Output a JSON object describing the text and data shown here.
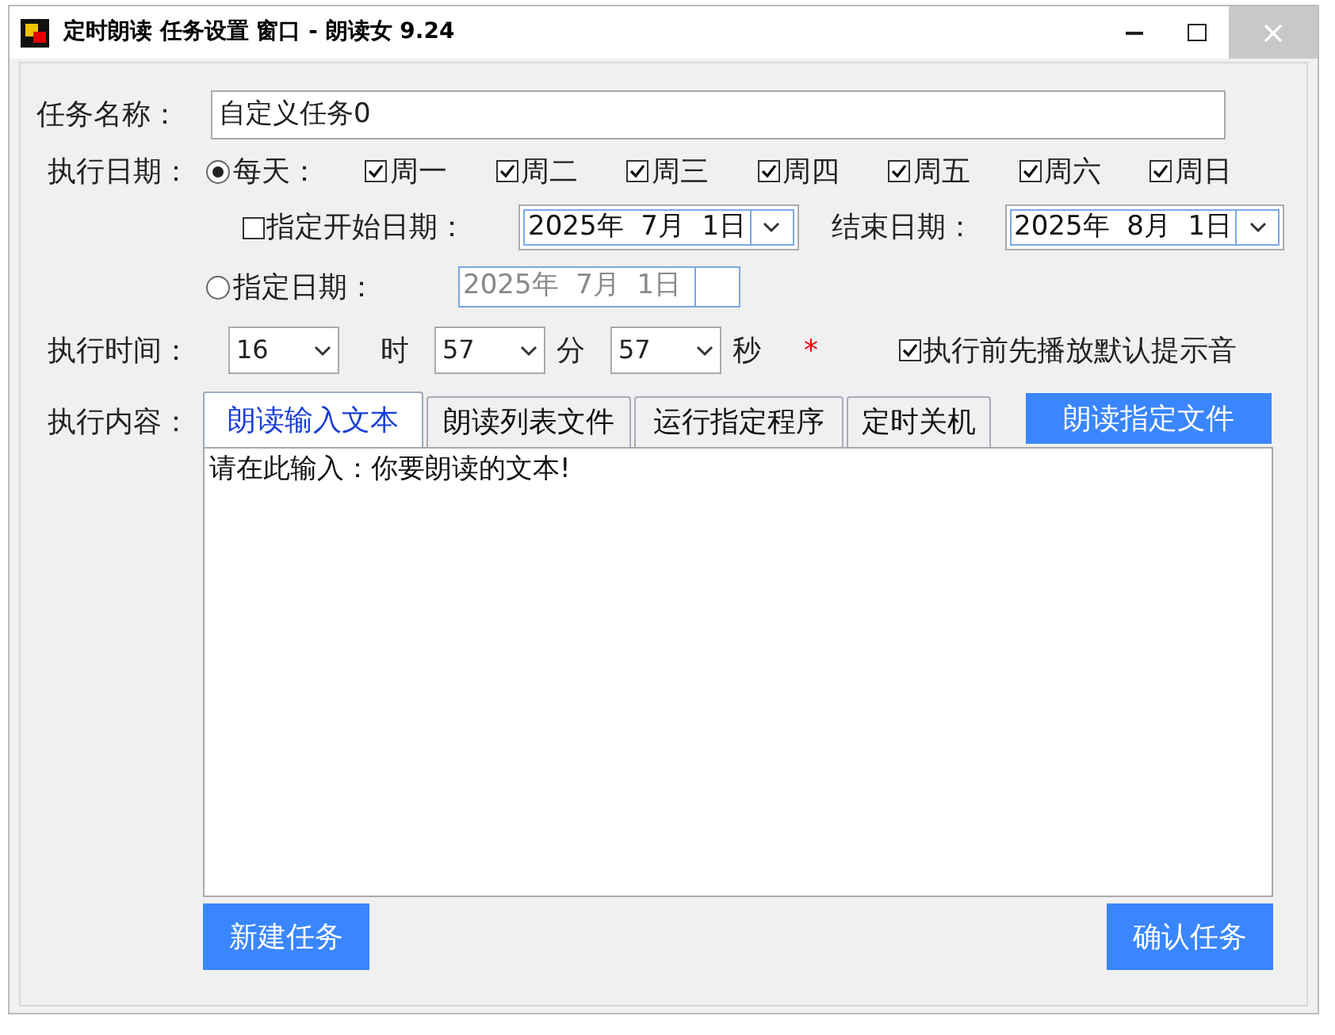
{
  "window": {
    "title": "定时朗读 任务设置 窗口 - 朗读女 9.24"
  },
  "task_name": {
    "label": "任务名称：",
    "value": "自定义任务0"
  },
  "date": {
    "label": "执行日期：",
    "daily": {
      "label": "每天：",
      "selected": true
    },
    "weekdays": [
      {
        "label": "周一",
        "checked": true
      },
      {
        "label": "周二",
        "checked": true
      },
      {
        "label": "周三",
        "checked": true
      },
      {
        "label": "周四",
        "checked": true
      },
      {
        "label": "周五",
        "checked": true
      },
      {
        "label": "周六",
        "checked": true
      },
      {
        "label": "周日",
        "checked": true
      }
    ],
    "start_date": {
      "label": "指定开始日期：",
      "checked": false,
      "value": "2025年  7月  1日"
    },
    "end_date": {
      "label": "结束日期：",
      "value": "2025年  8月  1日"
    },
    "specific": {
      "label": "指定日期：",
      "selected": false,
      "disabled": true,
      "value": "2025年  7月  1日"
    }
  },
  "time": {
    "label": "执行时间：",
    "hour": "16",
    "hour_unit": "时",
    "minute": "57",
    "minute_unit": "分",
    "second": "57",
    "second_unit": "秒",
    "required_mark": "*",
    "prompt_sound": {
      "label": "执行前先播放默认提示音",
      "checked": true
    }
  },
  "content": {
    "label": "执行内容：",
    "tabs": [
      {
        "label": "朗读输入文本",
        "selected": true
      },
      {
        "label": "朗读列表文件",
        "selected": false
      },
      {
        "label": "运行指定程序",
        "selected": false
      },
      {
        "label": "定时关机",
        "selected": false
      }
    ],
    "read_file_button": "朗读指定文件",
    "text": "请在此输入：你要朗读的文本!"
  },
  "buttons": [
    "新建任务",
    "确认任务"
  ]
}
